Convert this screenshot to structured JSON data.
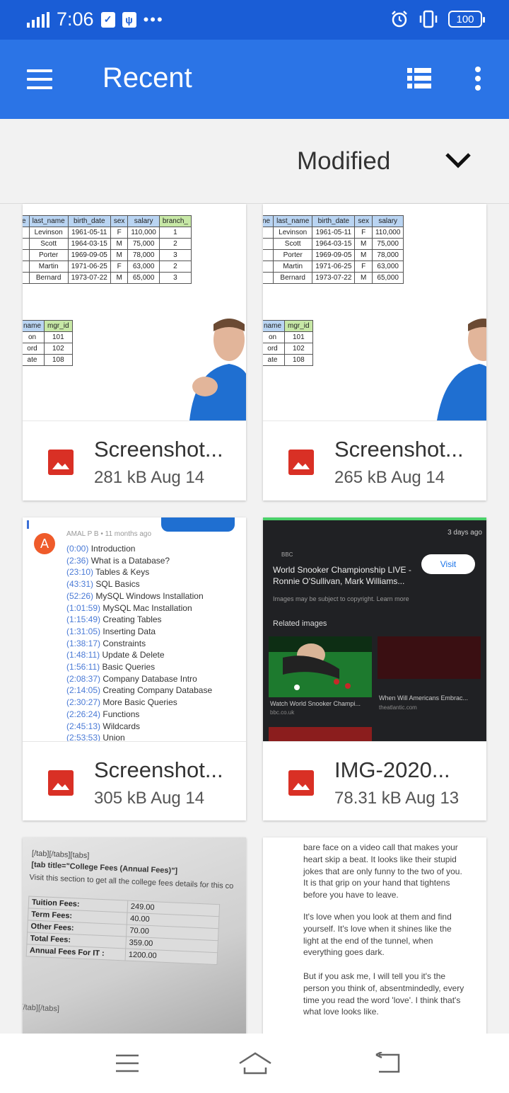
{
  "status": {
    "time": "7:06",
    "battery": "100"
  },
  "app_bar": {
    "title": "Recent"
  },
  "sort": {
    "label": "Modified"
  },
  "files": [
    {
      "name": "Screenshot...",
      "meta": "281 kB Aug 14"
    },
    {
      "name": "Screenshot...",
      "meta": "265 kB Aug 14"
    },
    {
      "name": "Screenshot...",
      "meta": "305 kB Aug 14"
    },
    {
      "name": "IMG-2020...",
      "meta": "78.31 kB Aug 13"
    }
  ],
  "thumb_table": {
    "headers": [
      "e",
      "last_name",
      "birth_date",
      "sex",
      "salary",
      "branch_"
    ],
    "rows": [
      [
        "",
        "Levinson",
        "1961-05-11",
        "F",
        "110,000",
        "1"
      ],
      [
        "",
        "Scott",
        "1964-03-15",
        "M",
        "75,000",
        "2"
      ],
      [
        "",
        "Porter",
        "1969-09-05",
        "M",
        "78,000",
        "3"
      ],
      [
        "",
        "Martin",
        "1971-06-25",
        "F",
        "63,000",
        "2"
      ],
      [
        "",
        "Bernard",
        "1973-07-22",
        "M",
        "65,000",
        "3"
      ]
    ],
    "headers2": [
      "ne",
      "last_name",
      "birth_date",
      "sex",
      "salary"
    ],
    "mgr_headers": [
      "name",
      "mgr_id"
    ],
    "mgr_rows": [
      [
        "on",
        "101"
      ],
      [
        "ord",
        "102"
      ],
      [
        "ate",
        "108"
      ]
    ]
  },
  "thumb_db": {
    "author": "AMAL P B • 11 months ago",
    "avatar": "A",
    "lines": [
      [
        "(0:00)",
        "Introduction"
      ],
      [
        "(2:36)",
        "What is a Database?"
      ],
      [
        "(23:10)",
        "Tables & Keys"
      ],
      [
        "(43:31)",
        "SQL Basics"
      ],
      [
        "(52:26)",
        "MySQL Windows Installation"
      ],
      [
        "(1:01:59)",
        "MySQL Mac Installation"
      ],
      [
        "(1:15:49)",
        "Creating Tables"
      ],
      [
        "(1:31:05)",
        "Inserting Data"
      ],
      [
        "(1:38:17)",
        "Constraints"
      ],
      [
        "(1:48:11)",
        "Update & Delete"
      ],
      [
        "(1:56:11)",
        "Basic Queries"
      ],
      [
        "(2:08:37)",
        "Company Database Intro"
      ],
      [
        "(2:14:05)",
        "Creating Company Database"
      ],
      [
        "(2:30:27)",
        "More Basic Queries"
      ],
      [
        "(2:26:24)",
        "Functions"
      ],
      [
        "(2:45:13)",
        "Wildcards"
      ],
      [
        "(2:53:53)",
        "Union"
      ]
    ]
  },
  "thumb_snooker": {
    "ago": "3 days ago",
    "source": "BBC",
    "title": "World Snooker Championship LIVE - Ronnie O'Sullivan, Mark Williams...",
    "visit": "Visit",
    "notice": "Images may be subject to copyright. Learn more",
    "related": "Related images",
    "cap1": "Watch World Snooker Champi...",
    "cap1_src": "bbc.co.uk",
    "cap2": "When Will Americans Embrac...",
    "cap2_src": "theatlantic.com"
  },
  "thumb_fees": {
    "line1": "[/tab][/tabs][tabs]",
    "line2": "[tab title=\"College Fees (Annual Fees)\"]",
    "line3": "Visit this section to get all the college fees details for this co",
    "rows": [
      [
        "Tuition Fees:",
        "249.00"
      ],
      [
        "Term Fees:",
        "40.00"
      ],
      [
        "Other Fees:",
        "70.00"
      ],
      [
        "Total Fees:",
        "359.00"
      ],
      [
        "Annual Fees For IT :",
        "1200.00"
      ]
    ],
    "footer": "[/tab][/tabs]"
  },
  "thumb_text": {
    "p1": "bare face on a video call that makes your heart skip a beat. It looks like their stupid jokes that are only funny to the two of you. It is that grip on your hand that tightens before you have to leave.",
    "p2": "It's love when you look at them and find yourself. It's love when it shines like the light at the end of the tunnel, when everything goes dark.",
    "p3": "But if you ask me, I will tell you it's the person you think of, absentmindedly, every time you read the word 'love'. I think that's what love looks like."
  }
}
